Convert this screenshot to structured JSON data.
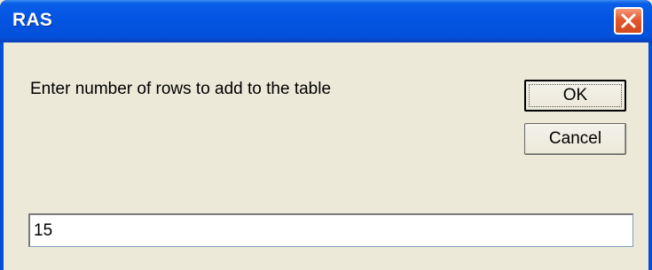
{
  "window": {
    "title": "RAS",
    "close_icon": "close-icon"
  },
  "dialog": {
    "prompt": "Enter number of rows to add to the table",
    "ok_label": "OK",
    "cancel_label": "Cancel",
    "input_value": "15"
  },
  "colors": {
    "titlebar": "#0455e3",
    "close_button": "#e3582f",
    "client_background": "#ece9d8"
  }
}
